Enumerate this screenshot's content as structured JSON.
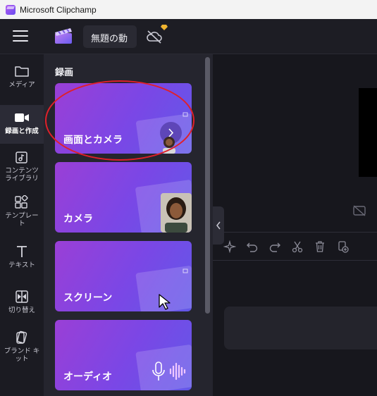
{
  "window": {
    "title": "Microsoft Clipchamp"
  },
  "topbar": {
    "project_name": "無題の動"
  },
  "nav": [
    {
      "id": "media",
      "label": "メディア"
    },
    {
      "id": "record",
      "label": "録画と作成"
    },
    {
      "id": "content",
      "label": "コンテンツ ライブラリ"
    },
    {
      "id": "templates",
      "label": "テンプレート"
    },
    {
      "id": "text",
      "label": "テキスト"
    },
    {
      "id": "transitions",
      "label": "切り替え"
    },
    {
      "id": "brand",
      "label": "ブランド キット"
    }
  ],
  "panel": {
    "title": "録画",
    "cards": [
      {
        "label": "画面とカメラ"
      },
      {
        "label": "カメラ"
      },
      {
        "label": "スクリーン"
      },
      {
        "label": "オーディオ"
      }
    ]
  },
  "colors": {
    "accent_purple": "#9a3fd6",
    "accent_blue": "#6258e8",
    "annotation_red": "#e0202a"
  },
  "icons": [
    "menu-icon",
    "clapper-icon",
    "cloud-off-icon",
    "premium-gem-icon",
    "folder-icon",
    "video-camera-icon",
    "music-library-icon",
    "templates-icon",
    "text-t-icon",
    "transition-icon",
    "brand-kit-icon",
    "chevron-left-icon",
    "magic-icon",
    "undo-icon",
    "redo-icon",
    "scissors-icon",
    "trash-icon",
    "add-copy-icon",
    "hide-preview-icon"
  ]
}
